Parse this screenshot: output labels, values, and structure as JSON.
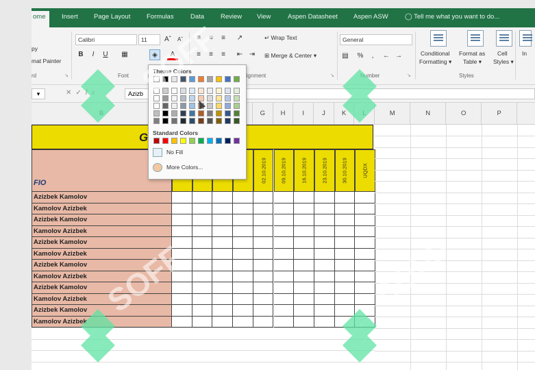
{
  "ribbon_tabs": [
    "ome",
    "Insert",
    "Page Layout",
    "Formulas",
    "Data",
    "Review",
    "View",
    "Aspen Datasheet",
    "Aspen ASW"
  ],
  "tell_me": "Tell me what you want to do...",
  "home": {
    "clipboard": {
      "copy": "py",
      "format_painter": "mat Painter",
      "group": "rd"
    },
    "font": {
      "name": "Calibri",
      "size": "11",
      "group": "Font"
    },
    "alignment": {
      "wrap_text": "Wrap Text",
      "merge_center": "Merge & Center",
      "group": "lignment"
    },
    "number": {
      "format": "General",
      "group": "Number"
    },
    "styles": {
      "conditional": [
        "Conditional",
        "Formatting"
      ],
      "format_table": [
        "Format as",
        "Table"
      ],
      "cell": [
        "Cell",
        "Styles"
      ],
      "group": "Styles"
    },
    "insert_partial": "In"
  },
  "formula_bar": {
    "name_box": "",
    "value": "Azizb"
  },
  "columns": [
    "B",
    "G",
    "H",
    "I",
    "J",
    "K",
    "L",
    "M",
    "N",
    "O",
    "P"
  ],
  "sheet": {
    "title": "G",
    "fio_label": "FIO",
    "dates": [
      "02.10.2019",
      "09.10.2019",
      "16.10.2019",
      "23.10.2019",
      "30.10.2019",
      "UQDX"
    ],
    "names": [
      "Azizbek Kamolov",
      "Kamolov Azizbek",
      "Azizbek Kamolov",
      "Kamolov Azizbek",
      "Azizbek Kamolov",
      "Kamolov Azizbek",
      "Azizbek Kamolov",
      "Kamolov Azizbek",
      "Azizbek Kamolov",
      "Kamolov Azizbek",
      "Azizbek Kamolov",
      "Kamolov Azizbek"
    ]
  },
  "fill_color_popup": {
    "theme_title": "Theme Colors",
    "standard_title": "Standard Colors",
    "no_fill": "No Fill",
    "more_colors": "More Colors...",
    "theme_row": [
      "#ffffff",
      "#000000",
      "#e7e6e6",
      "#44546a",
      "#5b9bd5",
      "#ed7d31",
      "#a5a5a5",
      "#ffc000",
      "#4472c4",
      "#70ad47"
    ],
    "standard_row": [
      "#c00000",
      "#ff0000",
      "#ffc000",
      "#ffff00",
      "#92d050",
      "#00b050",
      "#00b0f0",
      "#0070c0",
      "#002060",
      "#7030a0"
    ]
  },
  "watermark": "SOFF",
  "colors": {
    "excel_green": "#217346",
    "header_yellow": "#ecdc00",
    "name_fill": "#e8b9a6",
    "fio_blue": "#1b3d7a",
    "watermark_green": "#5fe3a3"
  }
}
